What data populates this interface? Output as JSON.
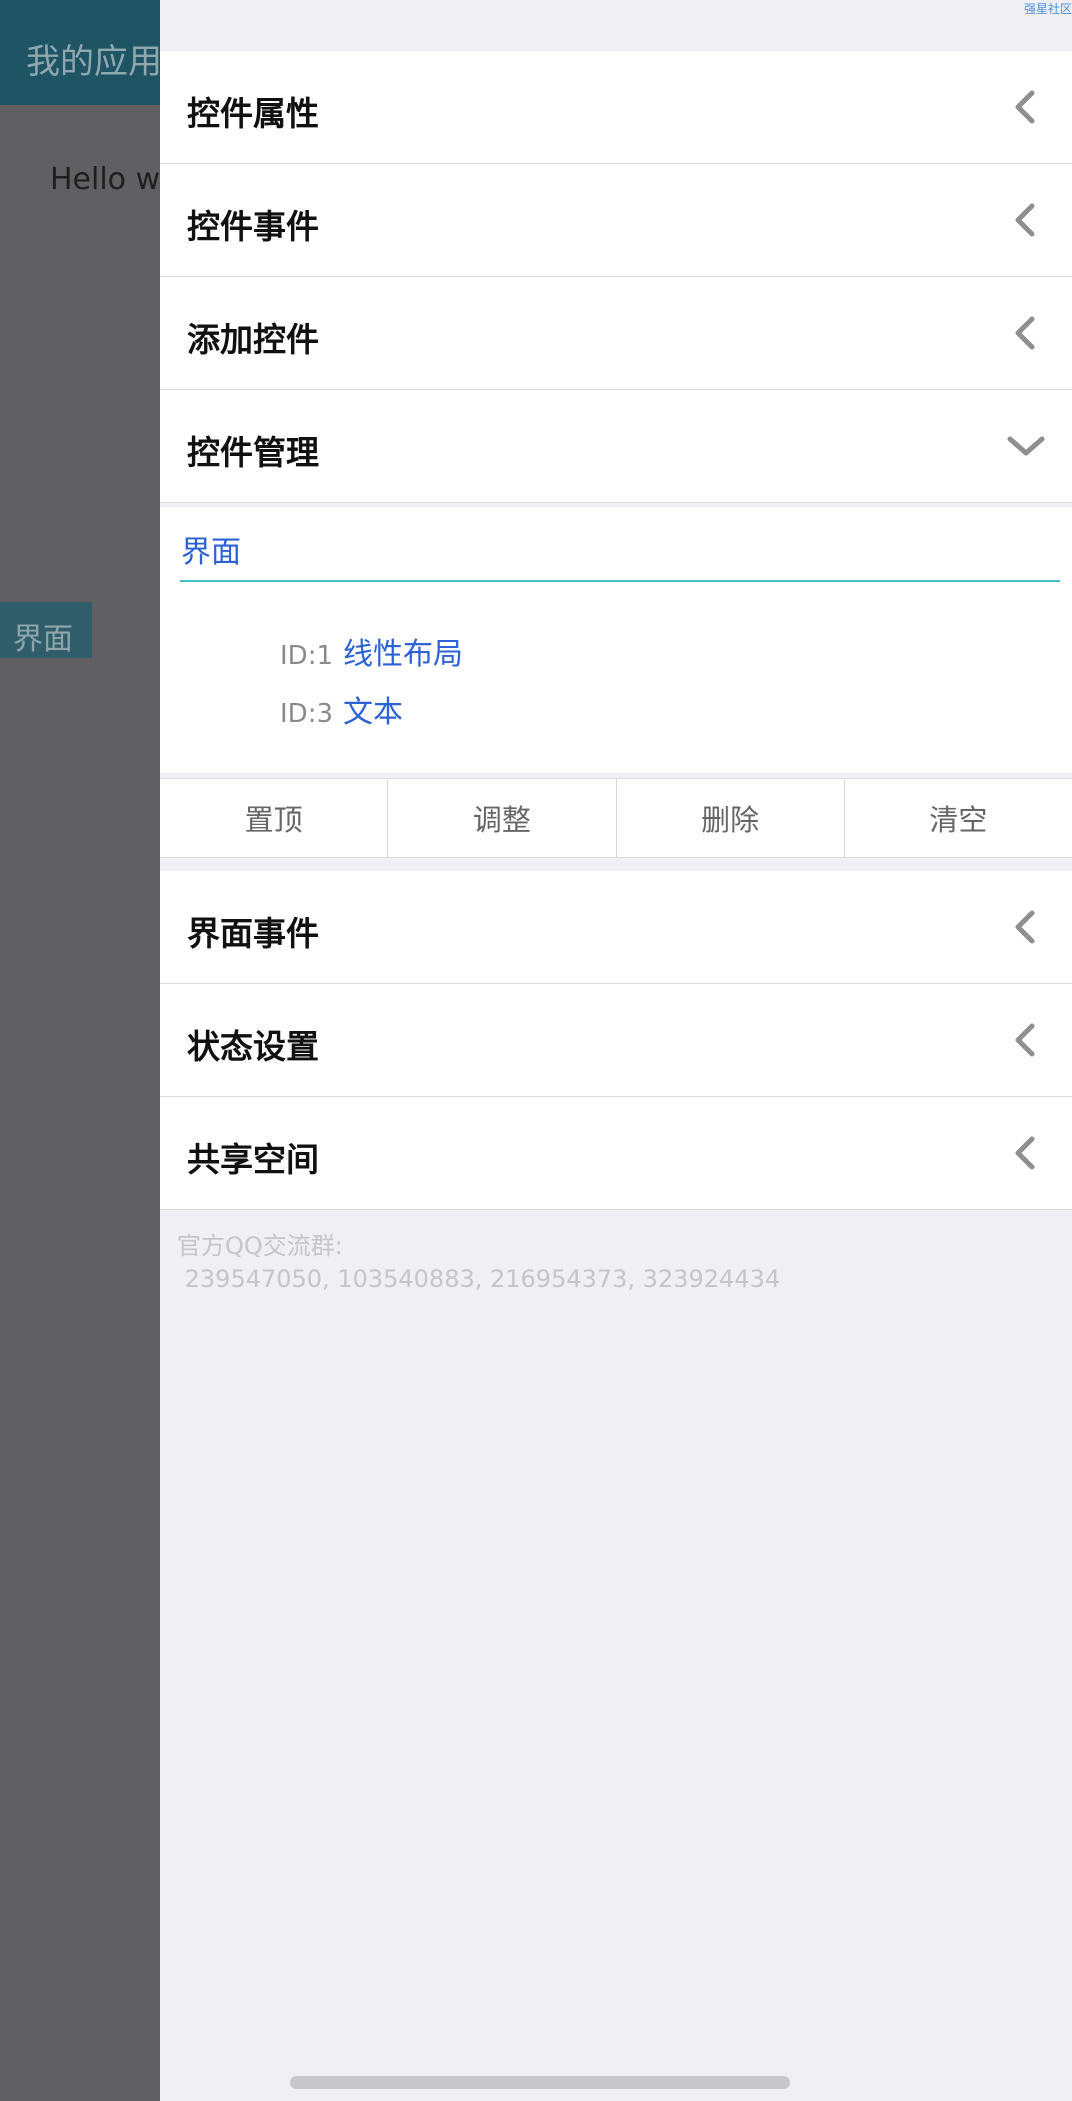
{
  "background_app": {
    "title": "我的应用",
    "hello_text": "Hello w",
    "view_tag": "界面"
  },
  "drawer": {
    "top_link": "强星社区",
    "sections_top": [
      {
        "label": "控件属性",
        "state": "collapsed"
      },
      {
        "label": "控件事件",
        "state": "collapsed"
      },
      {
        "label": "添加控件",
        "state": "collapsed"
      },
      {
        "label": "控件管理",
        "state": "expanded"
      }
    ],
    "control_manager": {
      "root_label": "界面",
      "children": [
        {
          "id_label": "ID:1",
          "name": "线性布局"
        },
        {
          "id_label": "ID:3",
          "name": "文本"
        }
      ],
      "actions": [
        "置顶",
        "调整",
        "删除",
        "清空"
      ]
    },
    "sections_bottom": [
      {
        "label": "界面事件",
        "state": "collapsed"
      },
      {
        "label": "状态设置",
        "state": "collapsed"
      },
      {
        "label": "共享空间",
        "state": "collapsed"
      }
    ],
    "footer": {
      "line1": "官方QQ交流群:",
      "line2": " 239547050, 103540883, 216954373, 323924434"
    }
  },
  "colors": {
    "accent_blue": "#2c62d6",
    "underline_teal": "#3fc0c8",
    "overlay_gray": "#606062"
  }
}
